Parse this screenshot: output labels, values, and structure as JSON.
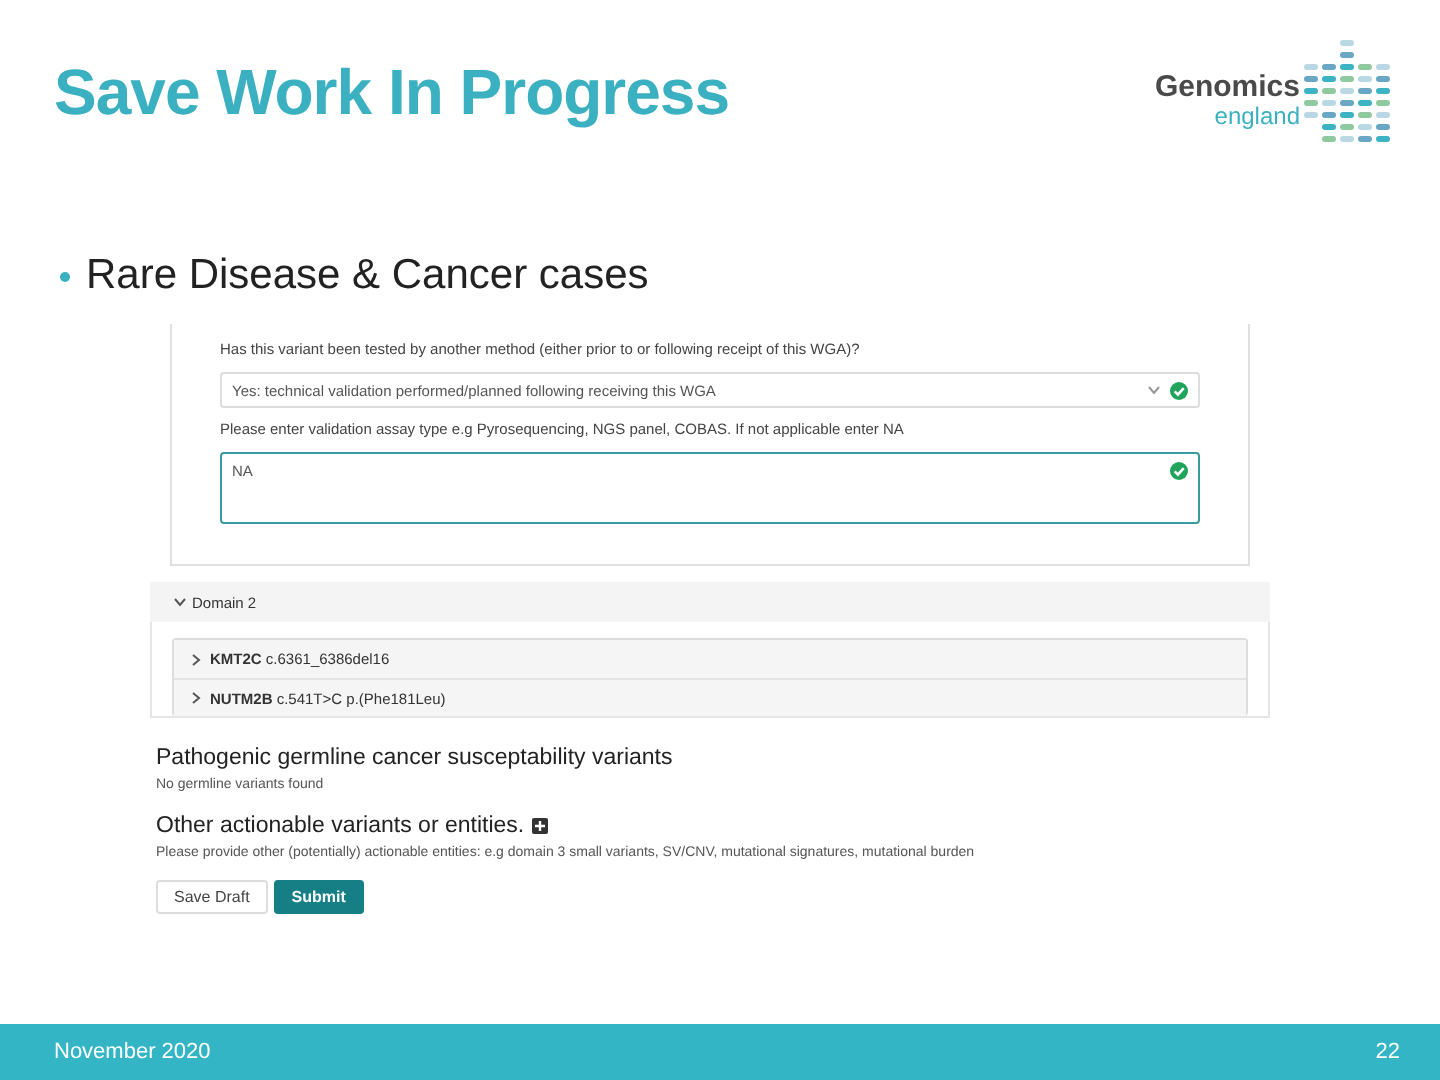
{
  "slide": {
    "title": "Save Work In Progress",
    "logo": {
      "name": "Genomics",
      "subname": "england"
    },
    "bullet": "Rare Disease & Cancer cases"
  },
  "form": {
    "fields": [
      {
        "kind": "select",
        "label": "Has this variant been tested by another method (either prior to or following receipt of this WGA)?",
        "value": "Yes: technical validation performed/planned following receiving this WGA",
        "valid": true
      },
      {
        "kind": "textarea",
        "label": "Please enter validation assay type e.g Pyrosequencing, NGS panel, COBAS. If not applicable enter NA",
        "value": "NA",
        "valid": true
      }
    ],
    "domain": {
      "label": "Domain 2",
      "expanded": true,
      "variants": [
        {
          "text": "**KMT2C** c.6361_6386del16",
          "expanded": false
        },
        {
          "text": "**NUTM2B** c.541T>C p.(Phe181Leu)",
          "expanded": false
        }
      ]
    },
    "sections": [
      {
        "heading": "Pathogenic germline cancer susceptability variants",
        "text": "No germline variants found",
        "add_button": false
      },
      {
        "heading": "Other actionable variants or entities.",
        "text": "Please provide other (potentially) actionable entities: e.g domain 3 small variants, SV/CNV, mutational signatures, mutational burden",
        "add_button": true
      }
    ],
    "buttons": [
      {
        "label": "Save Draft",
        "primary": false
      },
      {
        "label": "Submit",
        "primary": true
      }
    ]
  },
  "footer": {
    "date": "November 2020",
    "page": "22"
  }
}
